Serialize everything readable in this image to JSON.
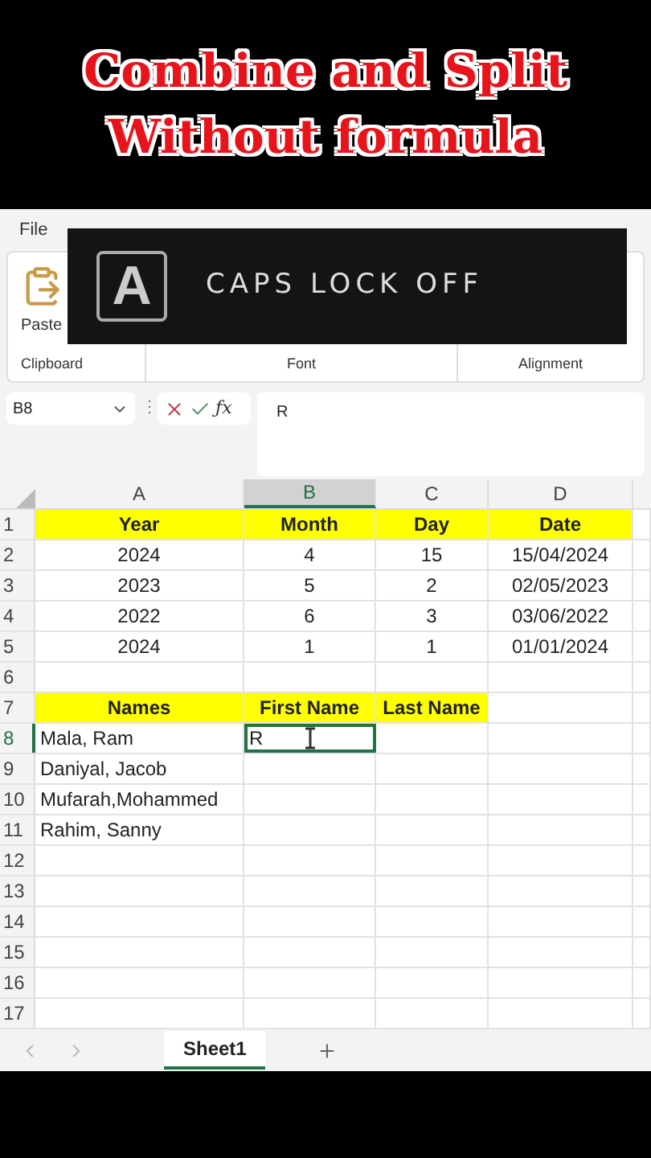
{
  "caption": [
    "Combine and Split",
    "Without formula"
  ],
  "ribbon": {
    "tabs": [
      {
        "label": "File",
        "selected": false
      }
    ],
    "paste_label": "Paste",
    "groups": [
      "Clipboard",
      "Font",
      "Alignment"
    ]
  },
  "overlay": {
    "key": "A",
    "text": "CAPS LOCK OFF"
  },
  "formula_bar": {
    "name_box": "B8",
    "separator": "⋮",
    "function_label": "ƒx",
    "content": "R"
  },
  "sheet": {
    "columns": [
      {
        "label": "A",
        "selected": false
      },
      {
        "label": "B",
        "selected": true
      },
      {
        "label": "C",
        "selected": false
      },
      {
        "label": "D",
        "selected": false
      }
    ],
    "rows": [
      {
        "number": "1",
        "selected": false,
        "kind": "header",
        "cells": [
          {
            "text": "Year",
            "active": false
          },
          {
            "text": "Month",
            "active": false
          },
          {
            "text": "Day",
            "active": false
          },
          {
            "text": "Date",
            "active": false
          }
        ]
      },
      {
        "number": "2",
        "selected": false,
        "kind": "center",
        "cells": [
          {
            "text": "2024",
            "active": false
          },
          {
            "text": "4",
            "active": false
          },
          {
            "text": "15",
            "active": false
          },
          {
            "text": "15/04/2024",
            "active": false
          }
        ]
      },
      {
        "number": "3",
        "selected": false,
        "kind": "center",
        "cells": [
          {
            "text": "2023",
            "active": false
          },
          {
            "text": "5",
            "active": false
          },
          {
            "text": "2",
            "active": false
          },
          {
            "text": "02/05/2023",
            "active": false
          }
        ]
      },
      {
        "number": "4",
        "selected": false,
        "kind": "center",
        "cells": [
          {
            "text": "2022",
            "active": false
          },
          {
            "text": "6",
            "active": false
          },
          {
            "text": "3",
            "active": false
          },
          {
            "text": "03/06/2022",
            "active": false
          }
        ]
      },
      {
        "number": "5",
        "selected": false,
        "kind": "center",
        "cells": [
          {
            "text": "2024",
            "active": false
          },
          {
            "text": "1",
            "active": false
          },
          {
            "text": "1",
            "active": false
          },
          {
            "text": "01/01/2024",
            "active": false
          }
        ]
      },
      {
        "number": "6",
        "selected": false,
        "kind": "center",
        "cells": []
      },
      {
        "number": "7",
        "selected": false,
        "kind": "header3",
        "cells": [
          {
            "text": "Names",
            "active": false
          },
          {
            "text": "First Name",
            "active": false
          },
          {
            "text": "Last Name",
            "active": false
          }
        ]
      },
      {
        "number": "8",
        "selected": true,
        "kind": "left",
        "cells": [
          {
            "text": "Mala, Ram",
            "active": false
          },
          {
            "text": "R",
            "active": true
          }
        ]
      },
      {
        "number": "9",
        "selected": false,
        "kind": "left",
        "cells": [
          {
            "text": "Daniyal, Jacob",
            "active": false
          }
        ]
      },
      {
        "number": "10",
        "selected": false,
        "kind": "left",
        "cells": [
          {
            "text": "Mufarah,Mohammed",
            "active": false
          }
        ]
      },
      {
        "number": "11",
        "selected": false,
        "kind": "left",
        "cells": [
          {
            "text": "Rahim, Sanny",
            "active": false
          }
        ]
      },
      {
        "number": "12",
        "selected": false,
        "kind": "left",
        "cells": []
      },
      {
        "number": "13",
        "selected": false,
        "kind": "left",
        "cells": []
      },
      {
        "number": "14",
        "selected": false,
        "kind": "left",
        "cells": []
      },
      {
        "number": "15",
        "selected": false,
        "kind": "left",
        "cells": []
      },
      {
        "number": "16",
        "selected": false,
        "kind": "left",
        "cells": []
      },
      {
        "number": "17",
        "selected": false,
        "kind": "left",
        "cells": []
      }
    ]
  },
  "sheet_tabs": [
    {
      "label": "Sheet1",
      "selected": true
    }
  ]
}
